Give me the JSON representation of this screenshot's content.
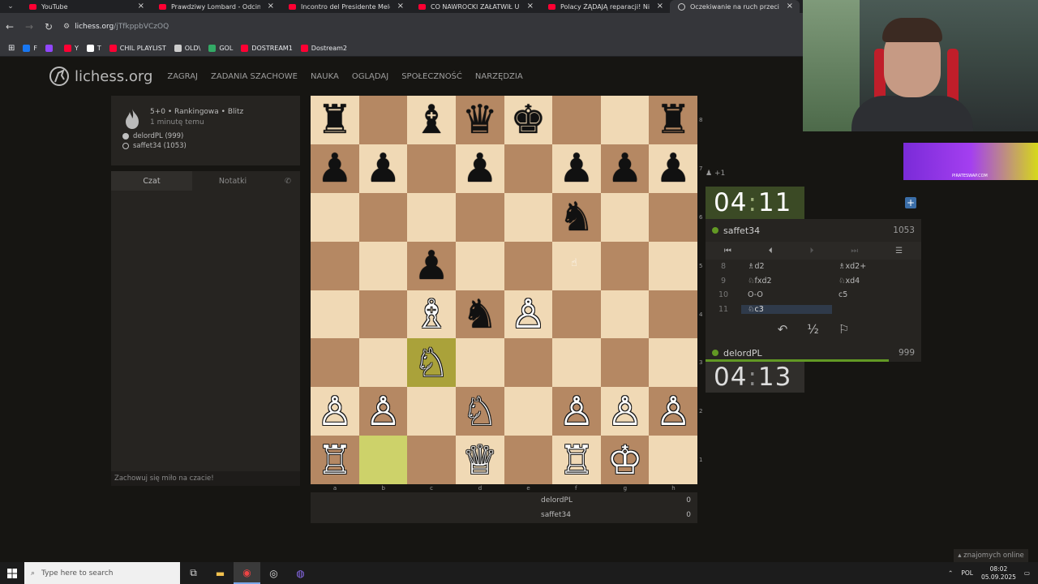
{
  "browser": {
    "tabs": [
      {
        "title": "YouTube",
        "icon": "youtube-icon"
      },
      {
        "title": "Prawdziwy Lombard - Odcinek",
        "icon": "youtube-icon"
      },
      {
        "title": "Incontro del Presidente Meloni",
        "icon": "youtube-icon"
      },
      {
        "title": "CO NAWROCKI ZAŁATWIŁ U TR",
        "icon": "youtube-icon"
      },
      {
        "title": "Polacy ŻĄDAJĄ reparacji! Niem",
        "icon": "youtube-icon"
      },
      {
        "title": "Oczekiwanie na ruch przeciwnik",
        "icon": "lichess-icon"
      }
    ],
    "url_host": "lichess.org",
    "url_path": "/jTfkppbVCzOQ",
    "bookmarks": [
      {
        "label": "F",
        "color": "#1877f2"
      },
      {
        "label": "",
        "color": "#9146ff"
      },
      {
        "label": "Y",
        "color": "#ff0033"
      },
      {
        "label": "T",
        "color": "#ffffff"
      },
      {
        "label": "CHIL PLAYLIST",
        "color": "#ff0033"
      },
      {
        "label": "OLD\\",
        "color": "#cccccc"
      },
      {
        "label": "GOL",
        "color": "#3a6"
      },
      {
        "label": "DOSTREAM1",
        "color": "#ff0033"
      },
      {
        "label": "Dostream2",
        "color": "#ff0033"
      }
    ]
  },
  "site": {
    "logo_text": "lichess.org",
    "nav": [
      "ZAGRAJ",
      "ZADANIA SZACHOWE",
      "NAUKA",
      "OGLĄDAJ",
      "SPOŁECZNOŚĆ",
      "NARZĘDZIA"
    ]
  },
  "game": {
    "setup": "5+0 • Rankingowa • Blitz",
    "time_ago": "1 minutę temu",
    "white": "delordPL (999)",
    "black": "saffet34 (1053)"
  },
  "chat": {
    "tab_chat": "Czat",
    "tab_notes": "Notatki",
    "footer": "Zachowuj się miło na czacie!"
  },
  "board": {
    "ranks": [
      [
        "♜",
        "",
        "♝",
        "♛",
        "♚",
        "",
        "",
        "♜"
      ],
      [
        "♟",
        "♟",
        "",
        "♟",
        "",
        "♟",
        "♟",
        "♟"
      ],
      [
        "",
        "",
        "",
        "",
        "",
        "♞",
        "",
        ""
      ],
      [
        "",
        "",
        "♟",
        "",
        "",
        "",
        "",
        ""
      ],
      [
        "",
        "",
        "♗",
        "♞",
        "♙",
        "",
        "",
        ""
      ],
      [
        "",
        "",
        "♘",
        "",
        "",
        "",
        "",
        ""
      ],
      [
        "♙",
        "♙",
        "",
        "♘",
        "",
        "♙",
        "♙",
        "♙"
      ],
      [
        "♖",
        "",
        "",
        "♕",
        "",
        "♖",
        "♔",
        ""
      ]
    ],
    "colors": [
      [
        "b",
        "b",
        "b",
        "b",
        "b",
        "",
        "",
        "b"
      ],
      [
        "b",
        "b",
        "",
        "b",
        "",
        "b",
        "b",
        "b"
      ],
      [
        "",
        "",
        "",
        "",
        "",
        "b",
        "",
        ""
      ],
      [
        "",
        "",
        "b",
        "",
        "",
        "",
        "",
        ""
      ],
      [
        "",
        "",
        "w",
        "b",
        "w",
        "",
        "",
        ""
      ],
      [
        "",
        "",
        "w",
        "",
        "",
        "",
        "",
        ""
      ],
      [
        "w",
        "w",
        "",
        "w",
        "",
        "w",
        "w",
        "w"
      ],
      [
        "w",
        "",
        "",
        "w",
        "",
        "w",
        "w",
        ""
      ]
    ],
    "highlights": [
      "c3",
      "b1"
    ],
    "files": [
      "a",
      "b",
      "c",
      "d",
      "e",
      "f",
      "g",
      "h"
    ],
    "rank_labels": [
      "8",
      "7",
      "6",
      "5",
      "4",
      "3",
      "2",
      "1"
    ]
  },
  "scores": [
    {
      "name": "delordPL",
      "score": "0"
    },
    {
      "name": "saffet34",
      "score": "0"
    }
  ],
  "right": {
    "spectators": "+1",
    "top_clock_min": "04",
    "top_clock_sec": "11",
    "top_player": "saffet34",
    "top_rating": "1053",
    "moves": [
      {
        "no": "8",
        "w": "♗d2",
        "b": "♗xd2+"
      },
      {
        "no": "9",
        "w": "♘fxd2",
        "b": "♘xd4"
      },
      {
        "no": "10",
        "w": "O-O",
        "b": "c5"
      },
      {
        "no": "11",
        "w": "♘c3",
        "b": ""
      }
    ],
    "draw_symbol": "½",
    "bottom_player": "delordPL",
    "bottom_rating": "999",
    "bottom_clock_min": "04",
    "bottom_clock_sec": "13",
    "top_time_fraction": 0.84,
    "bottom_time_fraction": 0.85
  },
  "overlay": {
    "ad_text": "PIRATESWAP.COM",
    "friends": "znajomych online"
  },
  "taskbar": {
    "search_placeholder": "Type here to search",
    "lang": "POL",
    "time": "08:02",
    "date": "05.09.2025"
  }
}
